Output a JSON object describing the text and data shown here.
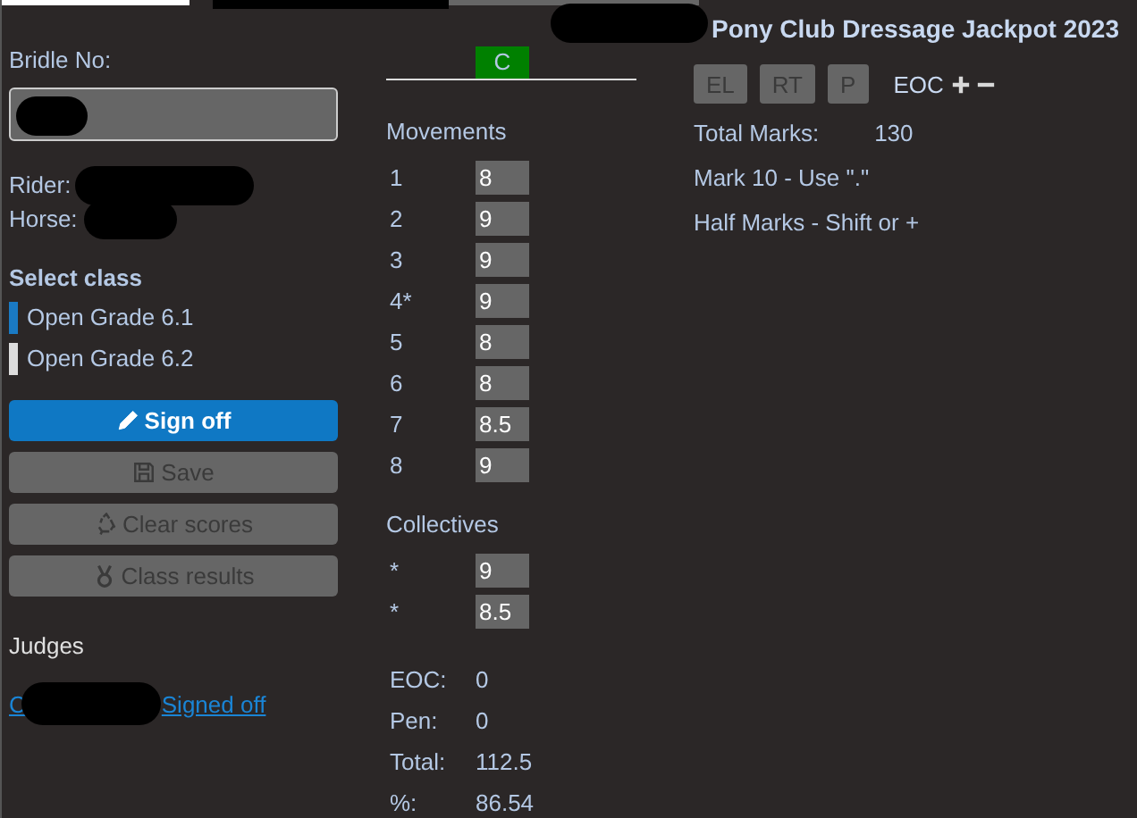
{
  "bridle": {
    "label": "Bridle No:"
  },
  "rider": {
    "label": "Rider:"
  },
  "horse": {
    "label": "Horse:"
  },
  "classes": {
    "title": "Select class",
    "items": [
      {
        "label": "Open Grade 6.1",
        "selected": true
      },
      {
        "label": "Open Grade 6.2",
        "selected": false
      }
    ]
  },
  "actions": [
    {
      "label": "Sign off",
      "kind": "signoff",
      "disabled": false
    },
    {
      "label": "Save",
      "kind": "save",
      "disabled": true
    },
    {
      "label": "Clear scores",
      "kind": "clear",
      "disabled": true
    },
    {
      "label": "Class results",
      "kind": "results",
      "disabled": true
    }
  ],
  "judges": {
    "title": "Judges",
    "entries": [
      {
        "initial": "C",
        "status": "Signed off"
      }
    ]
  },
  "position": {
    "label": "C"
  },
  "movements": {
    "title": "Movements",
    "rows": [
      {
        "number": "1",
        "score": "8"
      },
      {
        "number": "2",
        "score": "9"
      },
      {
        "number": "3",
        "score": "9"
      },
      {
        "number": "4*",
        "score": "9"
      },
      {
        "number": "5",
        "score": "8"
      },
      {
        "number": "6",
        "score": "8"
      },
      {
        "number": "7",
        "score": "8.5"
      },
      {
        "number": "8",
        "score": "9"
      }
    ]
  },
  "collectives": {
    "title": "Collectives",
    "rows": [
      {
        "number": "*",
        "score": "9"
      },
      {
        "number": "*",
        "score": "8.5"
      }
    ]
  },
  "summary": [
    {
      "label": "EOC:",
      "value": "0"
    },
    {
      "label": "Pen:",
      "value": "0"
    },
    {
      "label": "Total:",
      "value": "112.5"
    },
    {
      "label": "%:",
      "value": "86.54"
    }
  ],
  "header": {
    "title": "Pony Club Dressage Jackpot 2023"
  },
  "toggles": [
    {
      "label": "EL"
    },
    {
      "label": "RT"
    },
    {
      "label": "P"
    }
  ],
  "eoc": {
    "label": "EOC"
  },
  "total_marks": {
    "label": "Total Marks:",
    "value": "130"
  },
  "notes": [
    "Mark 10 - Use \".\"",
    "Half Marks - Shift or +"
  ]
}
